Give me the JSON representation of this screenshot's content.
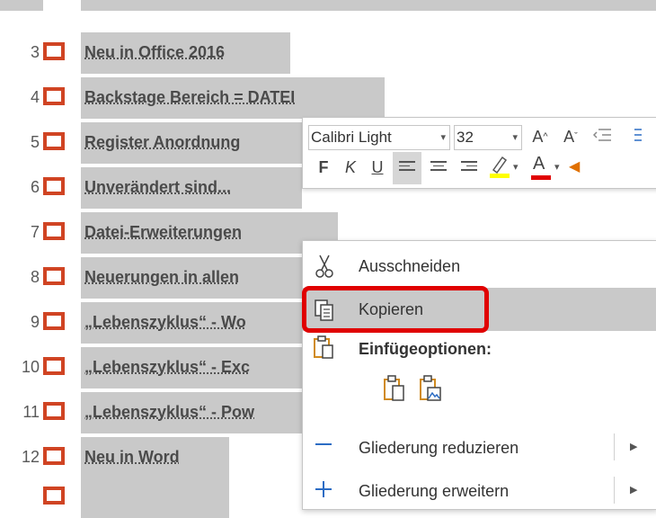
{
  "outline": {
    "rows": [
      {
        "num": "3",
        "text": "Neu in Office 2016"
      },
      {
        "num": "4",
        "text": "Backstage Bereich =  DATEI"
      },
      {
        "num": "5",
        "text": "Register Anordnung"
      },
      {
        "num": "6",
        "text": "Unverändert sind..."
      },
      {
        "num": "7",
        "text": "Datei-Erweiterungen"
      },
      {
        "num": "8",
        "text": "Neuerungen in allen"
      },
      {
        "num": "9",
        "text": "„Lebenszyklus“ - Wo"
      },
      {
        "num": "10",
        "text": "„Lebenszyklus“ - Exc"
      },
      {
        "num": "11",
        "text": "„Lebenszyklus“ - Pow"
      },
      {
        "num": "12",
        "text": "Neu in Word"
      }
    ]
  },
  "mini_toolbar": {
    "font_name": "Calibri Light",
    "font_size": "32",
    "grow_font": "A",
    "shrink_font": "A",
    "bold": "F",
    "italic": "K",
    "underline": "U",
    "font_color_letter": "A",
    "highlight_color": "#ffff00",
    "font_color": "#e00000"
  },
  "context_menu": {
    "cut": "Ausschneiden",
    "copy": "Kopieren",
    "paste_options": "Einfügeoptionen:",
    "collapse": "Gliederung reduzieren",
    "expand": "Gliederung erweitern"
  },
  "colors": {
    "slide_icon": "#d04423",
    "selection": "#c9c9c9",
    "highlight_box": "#e00000",
    "paste_icon": "#d08a1e"
  }
}
